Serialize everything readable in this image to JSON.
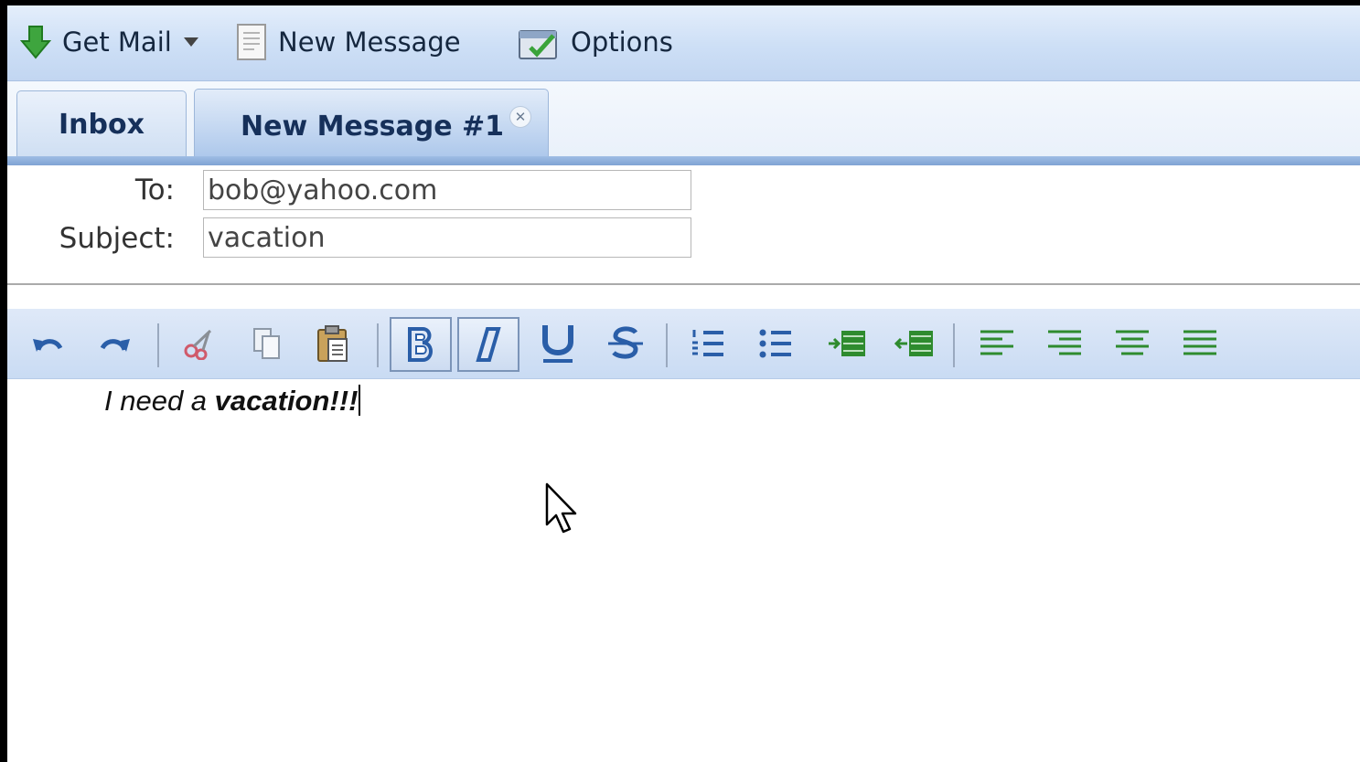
{
  "toolbar": {
    "get_mail": {
      "label": "Get Mail",
      "icon": "download-arrow-icon"
    },
    "new_message": {
      "label": "New Message",
      "icon": "document-icon"
    },
    "options": {
      "label": "Options",
      "icon": "options-icon"
    }
  },
  "tabs": [
    {
      "label": "Inbox",
      "active": false
    },
    {
      "label": "New Message #1",
      "active": true,
      "closable": true
    }
  ],
  "compose": {
    "to_label": "To:",
    "to_value": "bob@yahoo.com",
    "subject_label": "Subject:",
    "subject_value": "vacation"
  },
  "editor_toolbar": [
    {
      "name": "undo-icon"
    },
    {
      "name": "redo-icon"
    },
    {
      "name": "cut-icon"
    },
    {
      "name": "copy-icon"
    },
    {
      "name": "paste-icon"
    },
    {
      "name": "bold-icon",
      "pressed": true
    },
    {
      "name": "italic-icon",
      "pressed": true
    },
    {
      "name": "underline-icon"
    },
    {
      "name": "strikethrough-icon"
    },
    {
      "name": "ordered-list-icon"
    },
    {
      "name": "unordered-list-icon"
    },
    {
      "name": "indent-icon"
    },
    {
      "name": "outdent-icon"
    },
    {
      "name": "align-left-icon"
    },
    {
      "name": "align-right-icon"
    },
    {
      "name": "align-center-icon"
    },
    {
      "name": "align-justify-icon"
    }
  ],
  "editor": {
    "text_plain": "I need a ",
    "text_bold": "vacation!!!"
  },
  "colors": {
    "accent": "#7fa3d4",
    "toolbar_bg": "#cddff6",
    "icon_green": "#2e8b2e",
    "icon_blue": "#2a5ea8"
  }
}
